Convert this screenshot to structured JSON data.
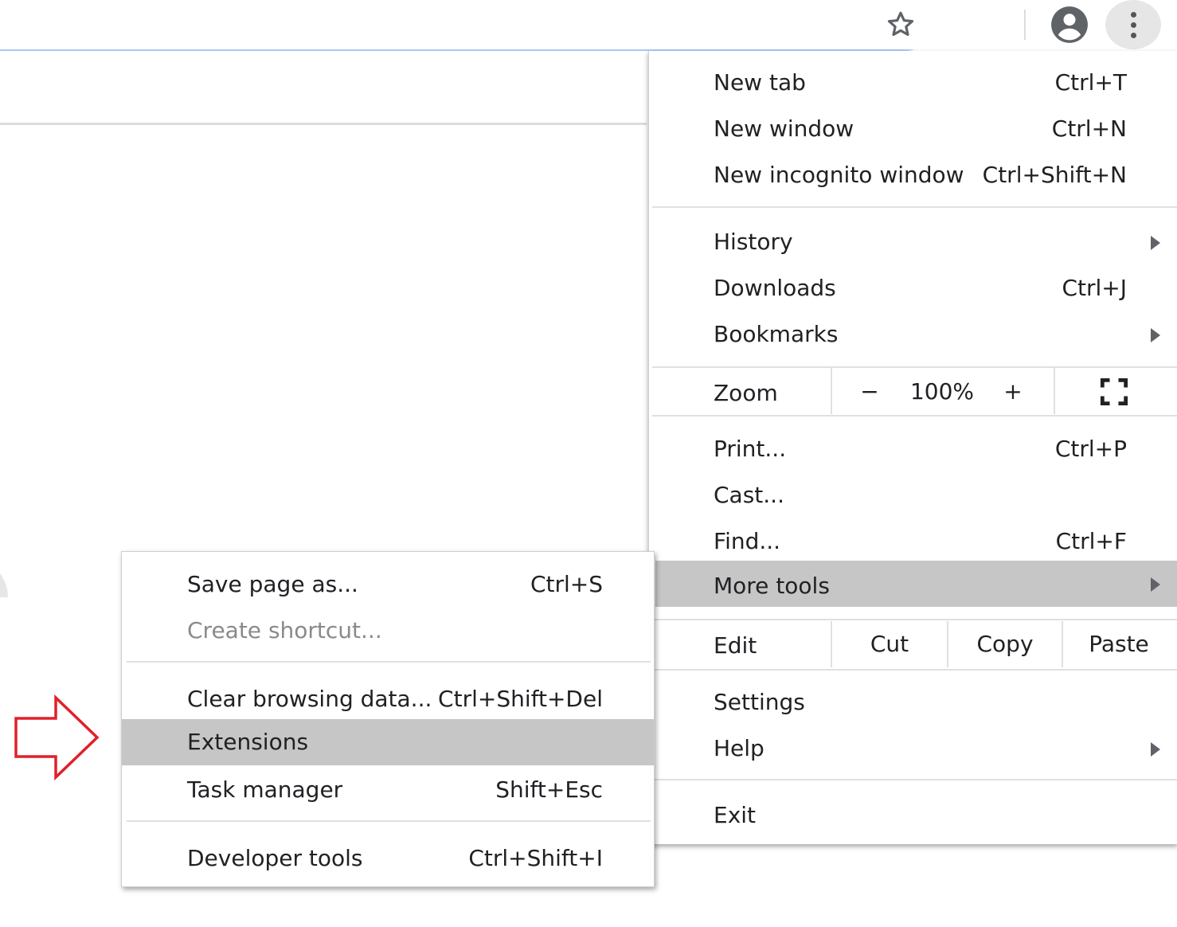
{
  "main_menu": {
    "items": [
      {
        "label": "New tab",
        "shortcut": "Ctrl+T"
      },
      {
        "label": "New window",
        "shortcut": "Ctrl+N"
      },
      {
        "label": "New incognito window",
        "shortcut": "Ctrl+Shift+N"
      },
      {
        "label": "History"
      },
      {
        "label": "Downloads",
        "shortcut": "Ctrl+J"
      },
      {
        "label": "Bookmarks"
      },
      {
        "label": "Print...",
        "shortcut": "Ctrl+P"
      },
      {
        "label": "Cast..."
      },
      {
        "label": "Find...",
        "shortcut": "Ctrl+F"
      },
      {
        "label": "More tools"
      },
      {
        "label": "Settings"
      },
      {
        "label": "Help"
      },
      {
        "label": "Exit"
      }
    ],
    "zoom": {
      "label": "Zoom",
      "minus": "−",
      "value": "100%",
      "plus": "+"
    },
    "edit": {
      "label": "Edit",
      "cut": "Cut",
      "copy": "Copy",
      "paste": "Paste"
    }
  },
  "sub_menu": {
    "items": [
      {
        "label": "Save page as...",
        "shortcut": "Ctrl+S"
      },
      {
        "label": "Create shortcut..."
      },
      {
        "label": "Clear browsing data...",
        "shortcut": "Ctrl+Shift+Del"
      },
      {
        "label": "Extensions"
      },
      {
        "label": "Task manager",
        "shortcut": "Shift+Esc"
      },
      {
        "label": "Developer tools",
        "shortcut": "Ctrl+Shift+I"
      }
    ]
  },
  "colors": {
    "highlight": "#c6c6c6",
    "annotation_arrow": "#e0202a",
    "focus_ring": "#a8c7fa",
    "disabled_text": "#8a8a8a"
  },
  "icons": {
    "star": "star-icon",
    "account": "account-circle-icon",
    "menu": "three-dots-vertical-icon",
    "fullscreen": "fullscreen-icon",
    "submenu": "chevron-right-icon"
  }
}
